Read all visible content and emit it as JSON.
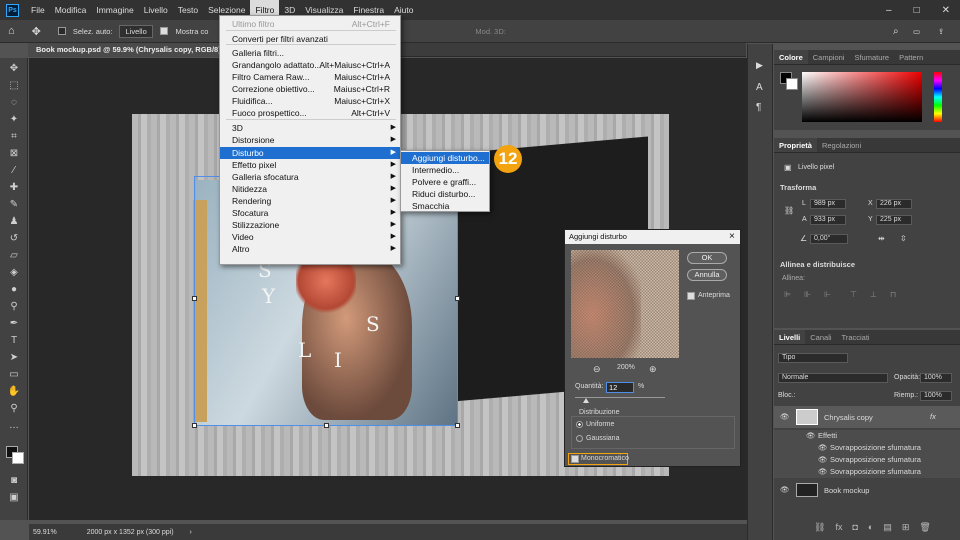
{
  "menubar": {
    "items": [
      "File",
      "Modifica",
      "Immagine",
      "Livello",
      "Testo",
      "Selezione",
      "Filtro",
      "3D",
      "Visualizza",
      "Finestra",
      "Aiuto"
    ],
    "active": "Filtro",
    "logo": "Ps"
  },
  "options": {
    "auto_select_label": "Selez. auto:",
    "auto_select_value": "Livello",
    "show_controls_label": "Mostra co",
    "mode_3d": "Mod. 3D:"
  },
  "document": {
    "tab": "Book mockup.psd @ 59.9% (Chrysalis copy, RGB/8) *",
    "zoom": "59.91%",
    "size": "2000 px x 1352 px (300 ppi)",
    "letters": [
      "S",
      "Y",
      "S",
      "L",
      "I"
    ]
  },
  "filter_menu": {
    "items": [
      {
        "label": "Ultimo filtro",
        "shortcut": "Alt+Ctrl+F",
        "disabled": true
      },
      {
        "label": "Converti per filtri avanzati"
      },
      {
        "label": "Galleria filtri..."
      },
      {
        "label": "Grandangolo adattato...",
        "shortcut": "Alt+Maiusc+Ctrl+A"
      },
      {
        "label": "Filtro Camera Raw...",
        "shortcut": "Maiusc+Ctrl+A"
      },
      {
        "label": "Correzione obiettivo...",
        "shortcut": "Maiusc+Ctrl+R"
      },
      {
        "label": "Fluidifica...",
        "shortcut": "Maiusc+Ctrl+X"
      },
      {
        "label": "Fuoco prospettico...",
        "shortcut": "Alt+Ctrl+V"
      },
      {
        "label": "3D"
      },
      {
        "label": "Distorsione"
      },
      {
        "label": "Disturbo"
      },
      {
        "label": "Effetto pixel"
      },
      {
        "label": "Galleria sfocatura"
      },
      {
        "label": "Nitidezza"
      },
      {
        "label": "Rendering"
      },
      {
        "label": "Sfocatura"
      },
      {
        "label": "Stilizzazione"
      },
      {
        "label": "Video"
      },
      {
        "label": "Altro"
      }
    ]
  },
  "noise_submenu": {
    "items": [
      "Aggiungi disturbo...",
      "Intermedio...",
      "Polvere e graffi...",
      "Riduci disturbo...",
      "Smacchia"
    ]
  },
  "step_badge": "12",
  "dialog": {
    "title": "Aggiungi disturbo",
    "ok": "OK",
    "cancel": "Annulla",
    "preview_label": "Anteprima",
    "zoom": "200%",
    "amount_label": "Quantità:",
    "amount_value": "12",
    "amount_unit": "%",
    "amount_fraction": 0.12,
    "distribution_label": "Distribuzione",
    "uniform": "Uniforme",
    "gaussian": "Gaussiana",
    "mono": "Monocromatico",
    "close": "×"
  },
  "color_panel": {
    "tabs": [
      "Colore",
      "Campioni",
      "Sfumature",
      "Pattern"
    ]
  },
  "properties": {
    "tabs": [
      "Proprietà",
      "Regolazioni"
    ],
    "type": "Livello pixel",
    "transform_label": "Trasforma",
    "W_label": "L",
    "W": "989 px",
    "H_label": "A",
    "H": "933 px",
    "X_label": "X",
    "X": "226 px",
    "Y_label": "Y",
    "Y": "225 px",
    "angle": "0,00°",
    "align_label": "Allinea e distribuisce",
    "align_sub": "Allinea:"
  },
  "layers": {
    "tabs": [
      "Livelli",
      "Canali",
      "Tracciati"
    ],
    "filter": "Tipo",
    "blend": "Normale",
    "opacity_label": "Opacità:",
    "opacity": "100%",
    "lock_label": "Bloc.:",
    "fill_label": "Riemp.:",
    "fill": "100%",
    "rows": [
      {
        "name": "Chrysalis copy",
        "fx": "fx"
      },
      {
        "name": "Effetti"
      },
      {
        "name": "Sovrapposizione sfumatura"
      },
      {
        "name": "Sovrapposizione sfumatura"
      },
      {
        "name": "Sovrapposizione sfumatura"
      },
      {
        "name": "Book mockup"
      }
    ]
  },
  "colors": {
    "accent": "#1e6fd0",
    "badge": "#f3a310",
    "selection": "#4f8fe8"
  }
}
